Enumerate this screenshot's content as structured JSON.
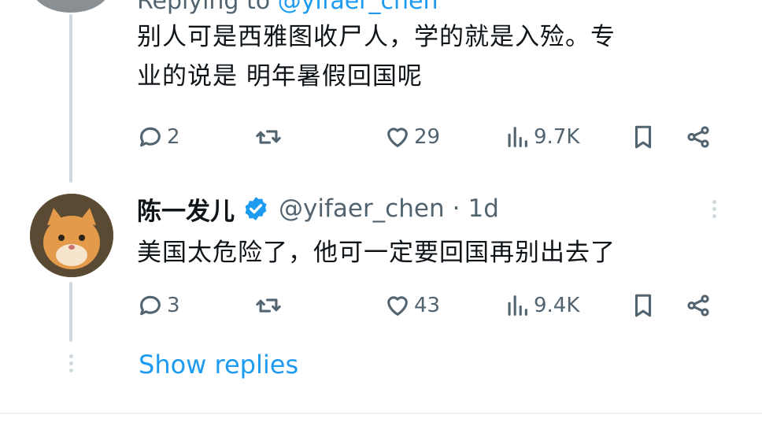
{
  "replying": {
    "prefix": "Replying to ",
    "handle": "@yifaer_chen"
  },
  "tweet1": {
    "text_line1": "别人可是西雅图收尸人，学的就是入殓。专",
    "text_line2": "业的说是 明年暑假回国呢",
    "replies": "2",
    "likes": "29",
    "views": "9.7K"
  },
  "tweet2": {
    "display_name": "陈一发儿",
    "handle": "@yifaer_chen",
    "separator": "·",
    "time": "1d",
    "text": "美国太危险了，他可一定要回国再别出去了",
    "replies": "3",
    "likes": "43",
    "views": "9.4K"
  },
  "show_replies": "Show replies",
  "icons": {
    "reply": "reply-icon",
    "retweet": "retweet-icon",
    "like": "heart-icon",
    "views": "views-icon",
    "bookmark": "bookmark-icon",
    "share": "share-icon",
    "verified": "verified-badge-icon",
    "more": "more-options-icon"
  },
  "colors": {
    "text": "#0f1419",
    "muted": "#536471",
    "link": "#1d9bf0",
    "thread_line": "#cfd9de"
  }
}
